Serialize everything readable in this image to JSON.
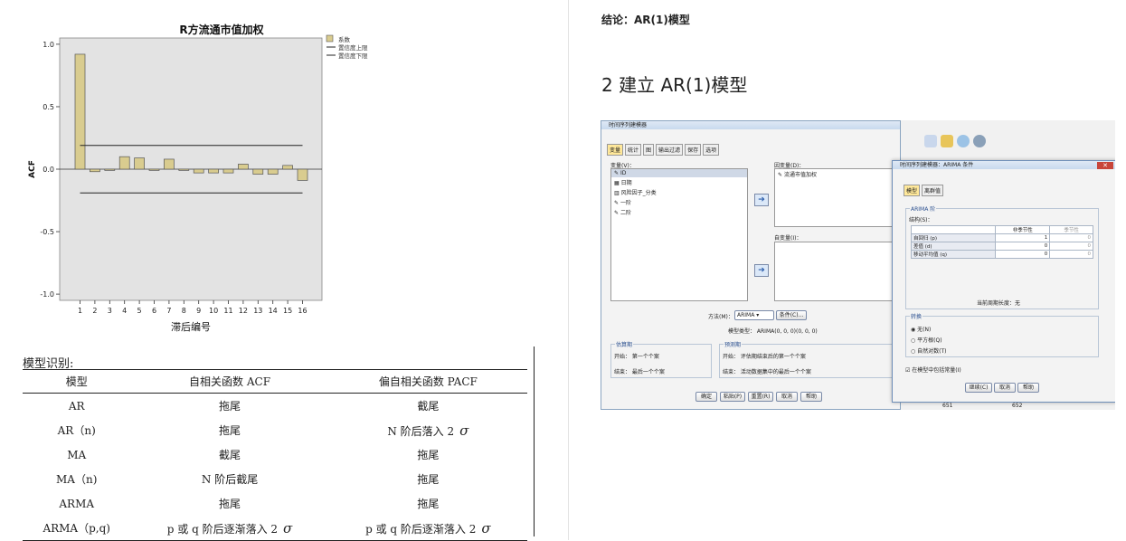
{
  "chart_data": {
    "type": "bar",
    "title": "R方流通市值加权",
    "xlabel": "滞后编号",
    "ylabel": "ACF",
    "categories": [
      "1",
      "2",
      "3",
      "4",
      "5",
      "6",
      "7",
      "8",
      "9",
      "10",
      "11",
      "12",
      "13",
      "14",
      "15",
      "16"
    ],
    "values": [
      0.92,
      -0.02,
      -0.01,
      0.1,
      0.09,
      -0.01,
      0.08,
      -0.01,
      -0.03,
      -0.03,
      -0.03,
      0.04,
      -0.04,
      -0.04,
      0.03,
      -0.09
    ],
    "ylim": [
      -1.05,
      1.05
    ],
    "yticks": [
      "1.0",
      "0.5",
      "0.0",
      "-0.5",
      "-1.0"
    ],
    "ytick_values": [
      1.0,
      0.5,
      0.0,
      -0.5,
      -1.0
    ],
    "upper_conf": 0.19,
    "lower_conf": -0.19,
    "legend": [
      "系数",
      "置信度上限",
      "置信度下限"
    ],
    "legend_position": "right",
    "bar_color": "#d9cc8f",
    "plot_bg": "#e3e3e3"
  },
  "table": {
    "title": "模型识别:",
    "headers": [
      "模型",
      "自相关函数 ACF",
      "偏自相关函数 PACF"
    ],
    "rows": [
      [
        "AR",
        "拖尾",
        "截尾"
      ],
      [
        "AR（n)",
        "拖尾",
        "N 阶后落入 2"
      ],
      [
        "MA",
        "截尾",
        "拖尾"
      ],
      [
        "MA（n)",
        "N 阶后截尾",
        "拖尾"
      ],
      [
        "ARMA",
        "拖尾",
        "拖尾"
      ],
      [
        "ARMA（p,q)",
        "p 或 q 阶后逐渐落入 2",
        "p 或 q 阶后逐渐落入 2"
      ]
    ],
    "sigma": "σ"
  },
  "right": {
    "conclusion": "结论：AR(1)模型",
    "heading": "2  建立 AR(1)模型"
  },
  "screenshot": {
    "win1_title": "时间序列建模器",
    "tabs": [
      "变量",
      "统计",
      "图",
      "输出过滤",
      "保存",
      "选项"
    ],
    "variables_label": "变量(V)：",
    "variables": [
      "ID",
      "日期",
      "风险因子_分类",
      "一阶",
      "二阶"
    ],
    "dependent_label": "因变量(D)：",
    "dependent_item": "流通市值加权",
    "independent_label": "自变量(I)：",
    "method_label": "方法(M)：",
    "method_value": "ARIMA",
    "criteria_btn": "条件(C)...",
    "model_type": "模型类型：  ARIMA(0, 0, 0)(0, 0, 0)",
    "estimation_title": "估算期",
    "estimation_start": "开始：  第一个个案",
    "estimation_end": "结束：  最后一个个案",
    "forecast_title": "预测期",
    "forecast_start": "开始：  评估期结束后的第一个个案",
    "forecast_end": "结束：  活动数据集中的最后一个个案",
    "bottom_buttons": [
      "确定",
      "粘贴(P)",
      "重置(R)",
      "取消",
      "帮助"
    ],
    "win2_title": "时间序列建模器：ARIMA 条件",
    "win2_tabs": [
      "模型",
      "离群值"
    ],
    "arima_group": "ARIMA 阶",
    "structure_label": "结构(S)：",
    "grid_headers": [
      "",
      "非季节性",
      "季节性"
    ],
    "grid_rows": [
      [
        "自回归 (p)",
        "1",
        "0"
      ],
      [
        "差值 (d)",
        "0",
        "0"
      ],
      [
        "移动平均值 (q)",
        "0",
        "0"
      ]
    ],
    "period_text": "当前周期长度：无",
    "transform_title": "转换",
    "transform_options": [
      "无(N)",
      "平方根(Q)",
      "自然对数(T)"
    ],
    "constant_label": "在模型中包括常量(I)",
    "win2_buttons": [
      "继续(C)",
      "取消",
      "帮助"
    ],
    "cell_values": [
      "651",
      "652"
    ]
  }
}
